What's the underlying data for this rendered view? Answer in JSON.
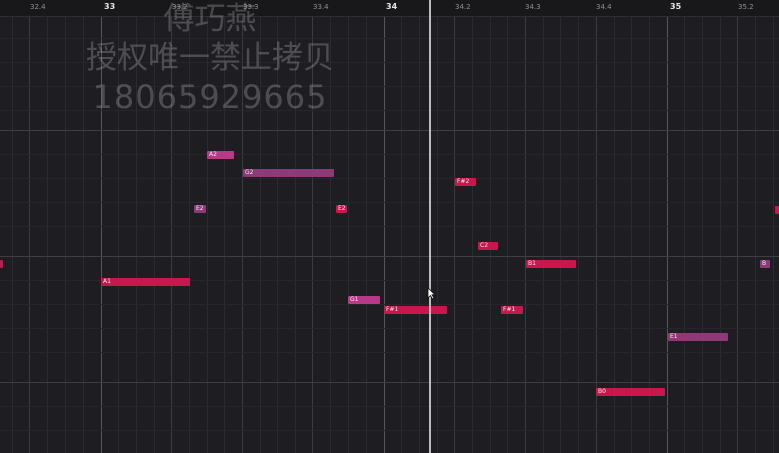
{
  "ruler": [
    {
      "label": "32.4",
      "bar": false
    },
    {
      "label": "33",
      "bar": true
    },
    {
      "label": "33.2",
      "bar": false
    },
    {
      "label": "33.3",
      "bar": false
    },
    {
      "label": "33.4",
      "bar": false
    },
    {
      "label": "34",
      "bar": true
    },
    {
      "label": "34.2",
      "bar": false
    },
    {
      "label": "34.3",
      "bar": false
    },
    {
      "label": "34.4",
      "bar": false
    },
    {
      "label": "35",
      "bar": true
    },
    {
      "label": "35.2",
      "bar": false
    }
  ],
  "watermark": {
    "name": "傅巧燕",
    "notice": "授权唯一禁止拷贝",
    "phone": "18065929665"
  },
  "colors": {
    "note_red": "#c8174c",
    "note_purple": "#8c3a78",
    "note_pink": "#b83a86",
    "background": "#1e1e22"
  },
  "notes": [
    {
      "label": "A2",
      "style": "pink"
    },
    {
      "label": "G2",
      "style": "purple"
    },
    {
      "label": "E2",
      "style": "purple"
    },
    {
      "label": "E2",
      "style": "red"
    },
    {
      "label": "F#2",
      "style": "red"
    },
    {
      "label": "C2",
      "style": "red"
    },
    {
      "label": "B1",
      "style": "red"
    },
    {
      "label": "B",
      "style": "purple"
    },
    {
      "label": "A1",
      "style": "red"
    },
    {
      "label": "G1",
      "style": "pink"
    },
    {
      "label": "F#1",
      "style": "red"
    },
    {
      "label": "F#1",
      "style": "red"
    },
    {
      "label": "E1",
      "style": "purple"
    },
    {
      "label": "B0",
      "style": "red"
    },
    {
      "label": "",
      "style": "red"
    },
    {
      "label": "",
      "style": "red"
    }
  ]
}
